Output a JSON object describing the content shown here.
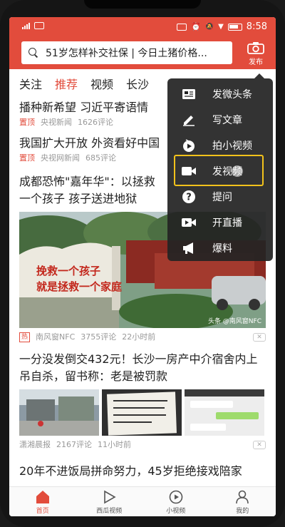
{
  "status_bar": {
    "time": "8:58"
  },
  "header": {
    "search_text": "51岁怎样补交社保 | 今日土猪价格...",
    "publish_label": "发布"
  },
  "tabs": [
    {
      "label": "关注",
      "active": false
    },
    {
      "label": "推荐",
      "active": true
    },
    {
      "label": "视频",
      "active": false
    },
    {
      "label": "长沙",
      "active": false
    }
  ],
  "feed": [
    {
      "title": "播种新希望 习近平寄语情",
      "tag": "置顶",
      "source": "央视新闻",
      "comments": "1626评论"
    },
    {
      "title": "我国扩大开放 外资看好中国",
      "tag": "置顶",
      "source": "央视网新闻",
      "comments": "685评论"
    },
    {
      "title": "成都恐怖\"嘉年华\"：以拯救一个孩子 孩子送进地狱",
      "image_slogan_1": "挽救一个孩子",
      "image_slogan_2": "就是拯救一个家庭",
      "watermark": "头条 @南风窗NFC",
      "badge": "热",
      "source": "南风窗NFC",
      "comments": "3755评论",
      "time": "22小时前"
    },
    {
      "title": "一分没发倒交432元！长沙一房产中介宿舍内上吊自杀，留书称：老是被罚款",
      "source": "潇湘晨报",
      "comments": "2167评论",
      "time": "11小时前"
    },
    {
      "title": "20年不进饭局拼命努力，45岁拒绝接戏陪家"
    }
  ],
  "popup_menu": {
    "items": [
      {
        "label": "发微头条",
        "icon": "document-icon"
      },
      {
        "label": "写文章",
        "icon": "pencil-icon"
      },
      {
        "label": "拍小视频",
        "icon": "play-circle-icon"
      },
      {
        "label": "发视频",
        "icon": "video-camera-icon",
        "highlighted": true
      },
      {
        "label": "提问",
        "icon": "question-icon"
      },
      {
        "label": "开直播",
        "icon": "live-icon"
      },
      {
        "label": "爆料",
        "icon": "megaphone-icon"
      }
    ]
  },
  "bottom_nav": [
    {
      "label": "首页",
      "icon": "home-icon",
      "active": true
    },
    {
      "label": "西瓜视频",
      "icon": "play-icon",
      "active": false
    },
    {
      "label": "小视频",
      "icon": "small-video-icon",
      "active": false
    },
    {
      "label": "我的",
      "icon": "user-icon",
      "active": false
    }
  ],
  "colors": {
    "accent": "#e24c3c",
    "highlight_box": "#f2c21b",
    "menu_bg": "#232323"
  }
}
